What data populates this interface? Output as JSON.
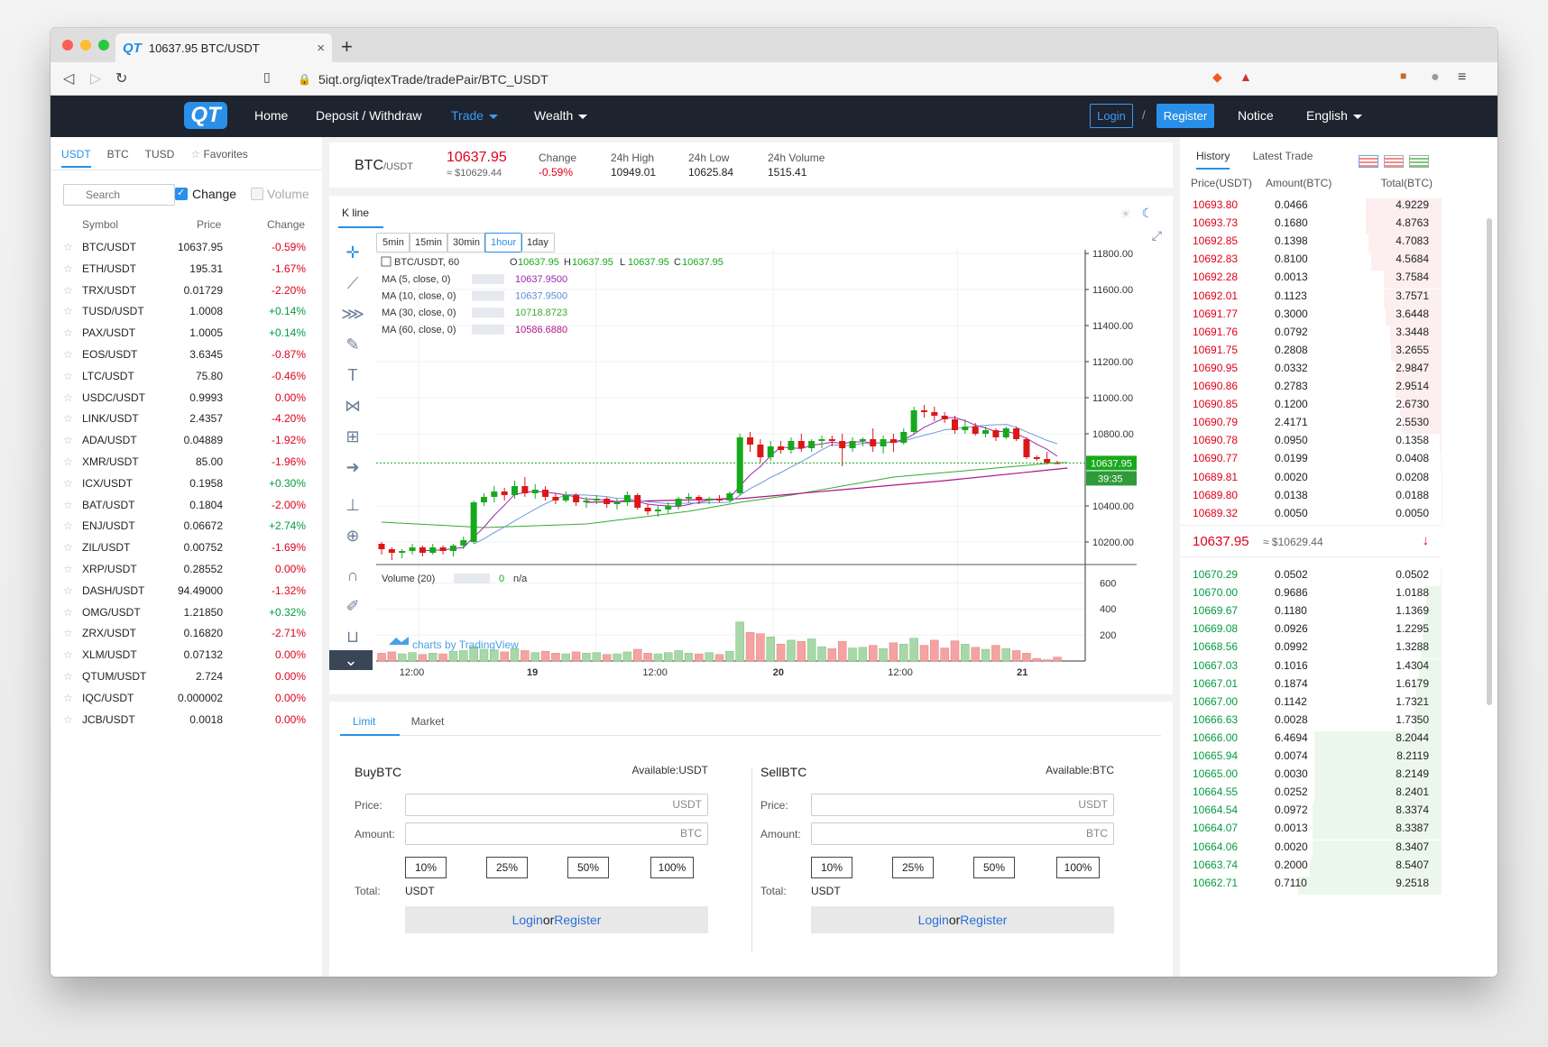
{
  "browser": {
    "tab_title": "10637.95 BTC/USDT",
    "tab_logo": "QT",
    "url": "5iqt.org/iqtexTrade/tradePair/BTC_USDT"
  },
  "nav": {
    "logo": "QT",
    "items": [
      "Home",
      "Deposit / Withdraw",
      "Trade",
      "Wealth"
    ],
    "login": "Login",
    "slash": "/",
    "register": "Register",
    "notice": "Notice",
    "language": "English"
  },
  "markets": {
    "tabs": [
      "USDT",
      "BTC",
      "TUSD",
      "Favorites"
    ],
    "search_placeholder": "Search",
    "change_label": "Change",
    "volume_label": "Volume",
    "headers": {
      "symbol": "Symbol",
      "price": "Price",
      "change": "Change"
    },
    "rows": [
      {
        "symbol": "BTC/USDT",
        "price": "10637.95",
        "change": "-0.59%"
      },
      {
        "symbol": "ETH/USDT",
        "price": "195.31",
        "change": "-1.67%"
      },
      {
        "symbol": "TRX/USDT",
        "price": "0.01729",
        "change": "-2.20%"
      },
      {
        "symbol": "TUSD/USDT",
        "price": "1.0008",
        "change": "+0.14%"
      },
      {
        "symbol": "PAX/USDT",
        "price": "1.0005",
        "change": "+0.14%"
      },
      {
        "symbol": "EOS/USDT",
        "price": "3.6345",
        "change": "-0.87%"
      },
      {
        "symbol": "LTC/USDT",
        "price": "75.80",
        "change": "-0.46%"
      },
      {
        "symbol": "USDC/USDT",
        "price": "0.9993",
        "change": "0.00%"
      },
      {
        "symbol": "LINK/USDT",
        "price": "2.4357",
        "change": "-4.20%"
      },
      {
        "symbol": "ADA/USDT",
        "price": "0.04889",
        "change": "-1.92%"
      },
      {
        "symbol": "XMR/USDT",
        "price": "85.00",
        "change": "-1.96%"
      },
      {
        "symbol": "ICX/USDT",
        "price": "0.1958",
        "change": "+0.30%"
      },
      {
        "symbol": "BAT/USDT",
        "price": "0.1804",
        "change": "-2.00%"
      },
      {
        "symbol": "ENJ/USDT",
        "price": "0.06672",
        "change": "+2.74%"
      },
      {
        "symbol": "ZIL/USDT",
        "price": "0.00752",
        "change": "-1.69%"
      },
      {
        "symbol": "XRP/USDT",
        "price": "0.28552",
        "change": "0.00%"
      },
      {
        "symbol": "DASH/USDT",
        "price": "94.49000",
        "change": "-1.32%"
      },
      {
        "symbol": "OMG/USDT",
        "price": "1.21850",
        "change": "+0.32%"
      },
      {
        "symbol": "ZRX/USDT",
        "price": "0.16820",
        "change": "-2.71%"
      },
      {
        "symbol": "XLM/USDT",
        "price": "0.07132",
        "change": "0.00%"
      },
      {
        "symbol": "QTUM/USDT",
        "price": "2.724",
        "change": "0.00%"
      },
      {
        "symbol": "IQC/USDT",
        "price": "0.000002",
        "change": "0.00%"
      },
      {
        "symbol": "JCB/USDT",
        "price": "0.0018",
        "change": "0.00%"
      }
    ]
  },
  "ticker": {
    "pair": "BTC",
    "quote": "/USDT",
    "last": "10637.95",
    "last_usd": "≈ $10629.44",
    "change_label": "Change",
    "change": "-0.59%",
    "high_label": "24h High",
    "high": "10949.01",
    "low_label": "24h Low",
    "low": "10625.84",
    "vol_label": "24h Volume",
    "volume": "1515.41"
  },
  "chart": {
    "tab": "K line",
    "intervals": [
      "5min",
      "15min",
      "30min",
      "1hour",
      "1day"
    ],
    "active_interval": "1hour",
    "legend_symbol": "BTC/USDT, 60",
    "ohlc": {
      "o": "10637.95",
      "h": "10637.95",
      "l": "10637.95",
      "c": "10637.95"
    },
    "ma_rows": [
      {
        "label": "MA (5, close, 0)",
        "value": "10637.9500",
        "color": "#9c27b0"
      },
      {
        "label": "MA (10, close, 0)",
        "value": "10637.9500",
        "color": "#5b8fd6"
      },
      {
        "label": "MA (30, close, 0)",
        "value": "10718.8723",
        "color": "#3aa82e"
      },
      {
        "label": "MA (60, close, 0)",
        "value": "10586.6880",
        "color": "#b0148a"
      }
    ],
    "volume_label": "Volume (20)",
    "volume_value": "0",
    "volume_na": "n/a",
    "price_tag": "10637.95",
    "countdown": "39:35",
    "watermark": "charts by TradingView"
  },
  "chart_data": {
    "type": "candlestick",
    "price_axis_ticks": [
      "11800.00",
      "11600.00",
      "11400.00",
      "11200.00",
      "11000.00",
      "10800.00",
      "10400.00",
      "10200.00"
    ],
    "volume_axis_ticks": [
      "600",
      "400",
      "200"
    ],
    "time_axis_ticks": [
      "12:00",
      "19",
      "12:00",
      "20",
      "12:00",
      "21"
    ],
    "ylim": [
      10080,
      11820
    ],
    "volume_ylim": [
      0,
      720
    ],
    "candles": [
      [
        10190,
        10200,
        10130,
        10160
      ],
      [
        10160,
        10170,
        10100,
        10140
      ],
      [
        10140,
        10160,
        10110,
        10150
      ],
      [
        10150,
        10190,
        10130,
        10170
      ],
      [
        10170,
        10180,
        10120,
        10140
      ],
      [
        10140,
        10190,
        10130,
        10170
      ],
      [
        10170,
        10180,
        10130,
        10150
      ],
      [
        10150,
        10190,
        10120,
        10180
      ],
      [
        10180,
        10230,
        10160,
        10210
      ],
      [
        10200,
        10430,
        10190,
        10420
      ],
      [
        10420,
        10470,
        10400,
        10450
      ],
      [
        10450,
        10510,
        10420,
        10480
      ],
      [
        10480,
        10500,
        10430,
        10460
      ],
      [
        10460,
        10540,
        10440,
        10510
      ],
      [
        10510,
        10560,
        10450,
        10470
      ],
      [
        10470,
        10520,
        10440,
        10490
      ],
      [
        10490,
        10510,
        10430,
        10450
      ],
      [
        10450,
        10470,
        10410,
        10430
      ],
      [
        10430,
        10480,
        10420,
        10460
      ],
      [
        10460,
        10470,
        10400,
        10420
      ],
      [
        10420,
        10450,
        10390,
        10430
      ],
      [
        10430,
        10460,
        10410,
        10440
      ],
      [
        10440,
        10450,
        10390,
        10410
      ],
      [
        10410,
        10440,
        10380,
        10420
      ],
      [
        10420,
        10480,
        10400,
        10460
      ],
      [
        10460,
        10470,
        10380,
        10390
      ],
      [
        10390,
        10410,
        10350,
        10370
      ],
      [
        10370,
        10400,
        10340,
        10380
      ],
      [
        10380,
        10420,
        10360,
        10400
      ],
      [
        10400,
        10450,
        10380,
        10440
      ],
      [
        10440,
        10470,
        10420,
        10450
      ],
      [
        10450,
        10460,
        10410,
        10430
      ],
      [
        10430,
        10450,
        10410,
        10440
      ],
      [
        10440,
        10460,
        10420,
        10430
      ],
      [
        10430,
        10480,
        10420,
        10470
      ],
      [
        10470,
        10800,
        10460,
        10780
      ],
      [
        10780,
        10810,
        10700,
        10740
      ],
      [
        10740,
        10770,
        10640,
        10670
      ],
      [
        10670,
        10760,
        10650,
        10730
      ],
      [
        10730,
        10760,
        10690,
        10710
      ],
      [
        10710,
        10780,
        10690,
        10760
      ],
      [
        10760,
        10800,
        10700,
        10720
      ],
      [
        10720,
        10770,
        10700,
        10760
      ],
      [
        10760,
        10790,
        10720,
        10770
      ],
      [
        10770,
        10790,
        10730,
        10760
      ],
      [
        10760,
        10800,
        10620,
        10720
      ],
      [
        10720,
        10780,
        10700,
        10760
      ],
      [
        10760,
        10780,
        10730,
        10770
      ],
      [
        10770,
        10830,
        10700,
        10730
      ],
      [
        10730,
        10790,
        10690,
        10770
      ],
      [
        10770,
        10800,
        10700,
        10750
      ],
      [
        10750,
        10830,
        10740,
        10810
      ],
      [
        10810,
        10950,
        10800,
        10930
      ],
      [
        10930,
        10960,
        10890,
        10920
      ],
      [
        10920,
        10950,
        10870,
        10900
      ],
      [
        10900,
        10920,
        10860,
        10880
      ],
      [
        10880,
        10900,
        10800,
        10820
      ],
      [
        10820,
        10880,
        10800,
        10840
      ],
      [
        10840,
        10860,
        10790,
        10800
      ],
      [
        10800,
        10840,
        10780,
        10820
      ],
      [
        10820,
        10830,
        10760,
        10780
      ],
      [
        10780,
        10840,
        10770,
        10830
      ],
      [
        10830,
        10840,
        10760,
        10770
      ],
      [
        10770,
        10780,
        10660,
        10670
      ],
      [
        10670,
        10680,
        10650,
        10660
      ],
      [
        10660,
        10700,
        10630,
        10640
      ],
      [
        10640,
        10650,
        10635,
        10637.95
      ]
    ],
    "volumes": [
      60,
      70,
      55,
      65,
      50,
      60,
      55,
      75,
      80,
      110,
      90,
      85,
      70,
      95,
      80,
      65,
      75,
      60,
      55,
      70,
      60,
      65,
      50,
      55,
      70,
      90,
      60,
      55,
      65,
      80,
      60,
      55,
      65,
      50,
      75,
      300,
      220,
      210,
      185,
      130,
      160,
      150,
      170,
      110,
      95,
      150,
      100,
      105,
      120,
      95,
      140,
      130,
      175,
      120,
      160,
      100,
      155,
      130,
      105,
      90,
      120,
      95,
      80,
      60,
      20,
      10,
      30
    ],
    "ma30_points": [
      [
        0,
        10310
      ],
      [
        10,
        10280
      ],
      [
        20,
        10300
      ],
      [
        30,
        10370
      ],
      [
        35,
        10420
      ],
      [
        40,
        10460
      ],
      [
        50,
        10560
      ],
      [
        60,
        10610
      ],
      [
        66,
        10640
      ],
      [
        67,
        10640
      ]
    ],
    "ma60_points": [
      [
        20,
        10420
      ],
      [
        35,
        10440
      ],
      [
        45,
        10490
      ],
      [
        55,
        10540
      ],
      [
        67,
        10610
      ]
    ]
  },
  "order": {
    "tabs": [
      "Limit",
      "Market"
    ],
    "buy": {
      "title": "BuyBTC",
      "available": "Available:USDT",
      "price_lbl": "Price:",
      "price_unit": "USDT",
      "amount_lbl": "Amount:",
      "amount_unit": "BTC",
      "total_lbl": "Total:",
      "total_unit": "USDT"
    },
    "sell": {
      "title": "SellBTC",
      "available": "Available:BTC",
      "price_lbl": "Price:",
      "price_unit": "USDT",
      "amount_lbl": "Amount:",
      "amount_unit": "BTC",
      "total_lbl": "Total:",
      "total_unit": "USDT"
    },
    "pcts": [
      "10%",
      "25%",
      "50%",
      "100%"
    ],
    "login": "Login",
    "or": "or",
    "register": "Register"
  },
  "book": {
    "tabs": [
      "History",
      "Latest Trade"
    ],
    "headers": {
      "price": "Price(USDT)",
      "amount": "Amount(BTC)",
      "total": "Total(BTC)"
    },
    "asks": [
      [
        "10693.80",
        "0.0466",
        "4.9229"
      ],
      [
        "10693.73",
        "0.1680",
        "4.8763"
      ],
      [
        "10692.85",
        "0.1398",
        "4.7083"
      ],
      [
        "10692.83",
        "0.8100",
        "4.5684"
      ],
      [
        "10692.28",
        "0.0013",
        "3.7584"
      ],
      [
        "10692.01",
        "0.1123",
        "3.7571"
      ],
      [
        "10691.77",
        "0.3000",
        "3.6448"
      ],
      [
        "10691.76",
        "0.0792",
        "3.3448"
      ],
      [
        "10691.75",
        "0.2808",
        "3.2655"
      ],
      [
        "10690.95",
        "0.0332",
        "2.9847"
      ],
      [
        "10690.86",
        "0.2783",
        "2.9514"
      ],
      [
        "10690.85",
        "0.1200",
        "2.6730"
      ],
      [
        "10690.79",
        "2.4171",
        "2.5530"
      ],
      [
        "10690.78",
        "0.0950",
        "0.1358"
      ],
      [
        "10690.77",
        "0.0199",
        "0.0408"
      ],
      [
        "10689.81",
        "0.0020",
        "0.0208"
      ],
      [
        "10689.80",
        "0.0138",
        "0.0188"
      ],
      [
        "10689.32",
        "0.0050",
        "0.0050"
      ]
    ],
    "mid_price": "10637.95",
    "mid_usd": "≈ $10629.44",
    "bids": [
      [
        "10670.29",
        "0.0502",
        "0.0502"
      ],
      [
        "10670.00",
        "0.9686",
        "1.0188"
      ],
      [
        "10669.67",
        "0.1180",
        "1.1369"
      ],
      [
        "10669.08",
        "0.0926",
        "1.2295"
      ],
      [
        "10668.56",
        "0.0992",
        "1.3288"
      ],
      [
        "10667.03",
        "0.1016",
        "1.4304"
      ],
      [
        "10667.01",
        "0.1874",
        "1.6179"
      ],
      [
        "10667.00",
        "0.1142",
        "1.7321"
      ],
      [
        "10666.63",
        "0.0028",
        "1.7350"
      ],
      [
        "10666.00",
        "6.4694",
        "8.2044"
      ],
      [
        "10665.94",
        "0.0074",
        "8.2119"
      ],
      [
        "10665.00",
        "0.0030",
        "8.2149"
      ],
      [
        "10664.55",
        "0.0252",
        "8.2401"
      ],
      [
        "10664.54",
        "0.0972",
        "8.3374"
      ],
      [
        "10664.07",
        "0.0013",
        "8.3387"
      ],
      [
        "10664.06",
        "0.0020",
        "8.3407"
      ],
      [
        "10663.74",
        "0.2000",
        "8.5407"
      ],
      [
        "10662.71",
        "0.7110",
        "9.2518"
      ]
    ]
  },
  "colors": {
    "up": "#039b41",
    "down": "#e0001a",
    "accent": "#2a8fe8",
    "nav_bg": "#1e2330"
  }
}
